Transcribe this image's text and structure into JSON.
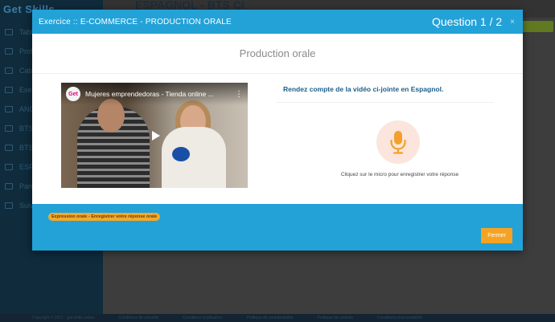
{
  "background": {
    "logo": "Get Skills",
    "page_title": "ESPAGNOL - BTS CI",
    "nav_items": [
      "Tableau",
      "Profil",
      "Catalogue",
      "Exercices",
      "ANGLAIS",
      "BTS",
      "BTS",
      "ESPAGNOL",
      "Parcours",
      "Suivi"
    ],
    "footer_links": [
      "Copyright © 2021 - get skills online",
      "Conditions de sécurité",
      "Conditions d'utilisation",
      "Politique de confidentialité",
      "Politique de cookies",
      "Conditions d'accessibilité"
    ]
  },
  "modal": {
    "title": "Exercice :: E-COMMERCE - PRODUCTION ORALE",
    "question_counter": "Question 1 / 2",
    "close_glyph": "×",
    "section_title": "Production orale",
    "video": {
      "channel_logo": "Get",
      "title": "Mujeres emprendedoras - Tienda online ...",
      "menu_glyph": "⋮"
    },
    "instruction": "Rendez compte de la vidéo ci-jointe en Espagnol.",
    "mic_hint": "Cliquez sur le micro pour enregistrer votre réponse",
    "tag": "Expression orale - Enregistrer votre réponse orale",
    "close_button": "Fermer"
  },
  "colors": {
    "accent": "#23a2d8",
    "button": "#f6a324",
    "mic": "#f3a02c",
    "mic_bg": "#fbe5dc"
  }
}
